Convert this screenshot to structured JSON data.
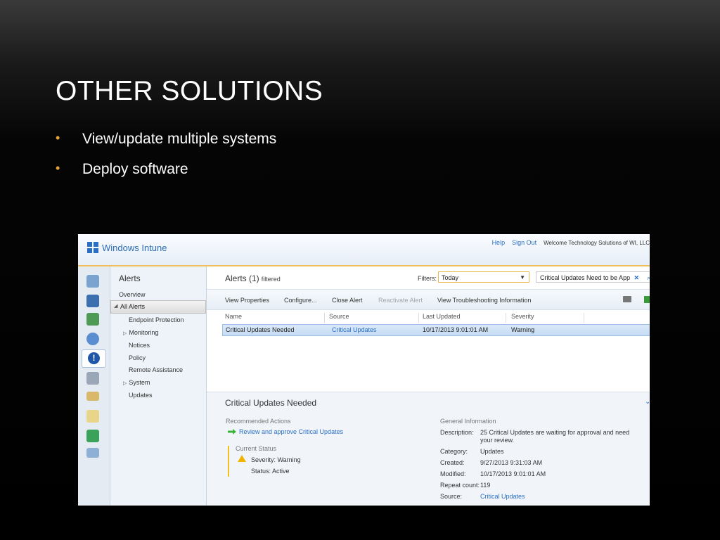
{
  "slide": {
    "title": "OTHER SOLUTIONS",
    "bullets": [
      "View/update multiple systems",
      "Deploy software"
    ]
  },
  "app": {
    "name": "Windows Intune",
    "links": {
      "help": "Help",
      "signout": "Sign Out"
    },
    "welcome": "Welcome Technology Solutions of WI, LLC"
  },
  "nav": {
    "heading": "Alerts",
    "items": [
      "Overview",
      "All Alerts",
      "Endpoint Protection",
      "Monitoring",
      "Notices",
      "Policy",
      "Remote Assistance",
      "System",
      "Updates"
    ]
  },
  "main": {
    "title": "Alerts (1)",
    "title_sub": "filtered",
    "filters_label": "Filters:",
    "filter_value": "Today",
    "search_value": "Critical Updates Need to be App"
  },
  "toolbar": {
    "view_properties": "View Properties",
    "configure": "Configure...",
    "close_alert": "Close Alert",
    "reactivate_alert": "Reactivate Alert",
    "view_troubleshooting": "View Troubleshooting Information"
  },
  "grid": {
    "columns": [
      "Name",
      "Source",
      "Last Updated",
      "Severity"
    ],
    "rows": [
      {
        "name": "Critical Updates Needed",
        "source": "Critical Updates",
        "last_updated": "10/17/2013 9:01:01 AM",
        "severity": "Warning"
      }
    ]
  },
  "details": {
    "title": "Critical Updates Needed",
    "recommended_label": "Recommended Actions",
    "recommended_action": "Review and approve Critical Updates",
    "current_status_label": "Current Status",
    "severity_text": "Severity: Warning",
    "status_text": "Status:   Active",
    "general_label": "General Information",
    "general": {
      "description_key": "Description:",
      "description": "25 Critical Updates are waiting for approval and need your review.",
      "category_key": "Category:",
      "category": "Updates",
      "created_key": "Created:",
      "created": "9/27/2013 9:31:03 AM",
      "modified_key": "Modified:",
      "modified": "10/17/2013 9:01:01 AM",
      "repeat_key": "Repeat count:",
      "repeat": "119",
      "source_key": "Source:",
      "source": "Critical Updates"
    }
  },
  "colors": {
    "accent": "#2a6fc4",
    "bullet": "#e8a33a",
    "highlight": "#f0c060"
  },
  "icons": [
    "desktop-icon",
    "update-icon",
    "software-icon",
    "shield-icon",
    "alert-icon",
    "policy-icon",
    "license-icon",
    "report-icon",
    "admin-icon",
    "settings-icon",
    "windows-logo-icon",
    "filter-dropdown-icon",
    "clear-search-icon",
    "search-icon",
    "print-icon",
    "export-icon",
    "green-arrow-icon",
    "warning-icon",
    "chevron-down-icon"
  ]
}
